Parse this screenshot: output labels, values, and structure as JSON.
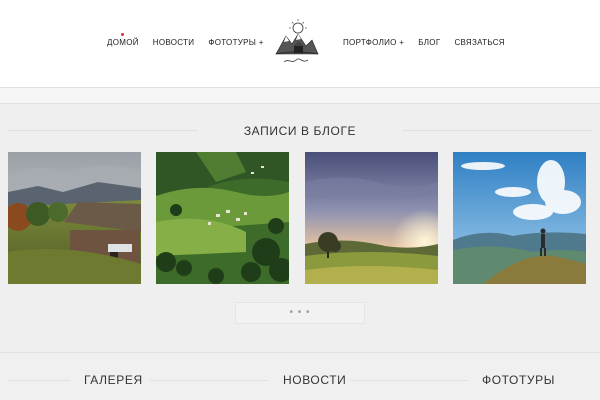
{
  "nav_left": [
    {
      "label": "ДОМОЙ",
      "active": true
    },
    {
      "label": "НОВОСТИ"
    },
    {
      "label": "ФОТОТУРЫ +"
    }
  ],
  "nav_right": [
    {
      "label": "ПОРТФОЛИО +"
    },
    {
      "label": "БЛОГ"
    },
    {
      "label": "СВЯЗАТЬСЯ"
    }
  ],
  "logo": {
    "icon": "mountain-logo-icon"
  },
  "blog": {
    "title": "ЗАПИСИ В БЛОГЕ",
    "more_label": "• • •"
  },
  "bottom": {
    "gallery": "ГАЛЕРЕЯ",
    "news": "НОВОСТИ",
    "tours": "ФОТОТУРЫ"
  },
  "colors": {
    "accent": "#dd3333",
    "background": "#efefef"
  }
}
